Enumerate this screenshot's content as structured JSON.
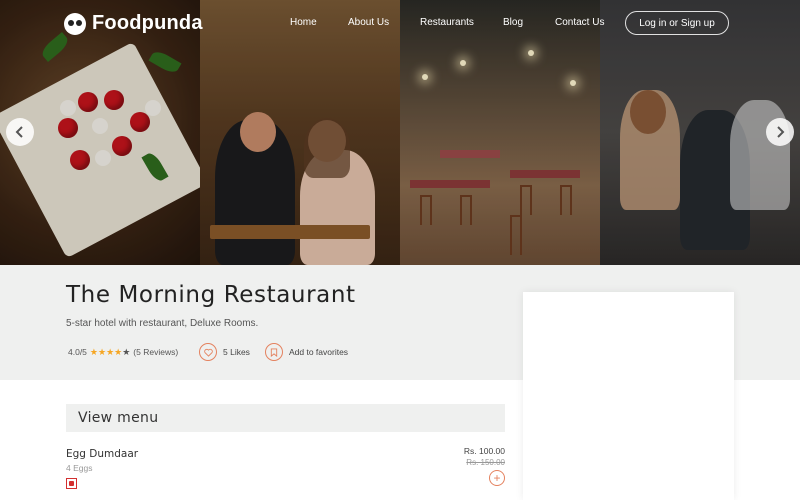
{
  "header": {
    "brand": "Foodpunda",
    "nav": [
      "Home",
      "About Us",
      "Restaurants",
      "Blog",
      "Contact Us"
    ],
    "login_label": "Log in or Sign up"
  },
  "carousel": {
    "prev_icon": "chevron-left-icon",
    "next_icon": "chevron-right-icon"
  },
  "restaurant": {
    "name": "The Morning Restaurant",
    "description": "5-star hotel with restaurant, Deluxe Rooms.",
    "rating_text": "4.0/5",
    "rating_value": 4,
    "rating_max": 5,
    "reviews_text": "(5 Reviews)",
    "likes_text": "5 Likes",
    "favorite_label": "Add to favorites"
  },
  "menu": {
    "heading": "View menu",
    "items": [
      {
        "name": "Egg Dumdaar",
        "description": "4 Eggs",
        "price": "Rs. 100.00",
        "old_price": "Rs. 150.00",
        "type": "non-veg"
      }
    ]
  },
  "colors": {
    "accent": "#e4825f",
    "star": "#f5a623",
    "section_bg": "#eff0ef",
    "nonveg": "#d32f2f"
  }
}
